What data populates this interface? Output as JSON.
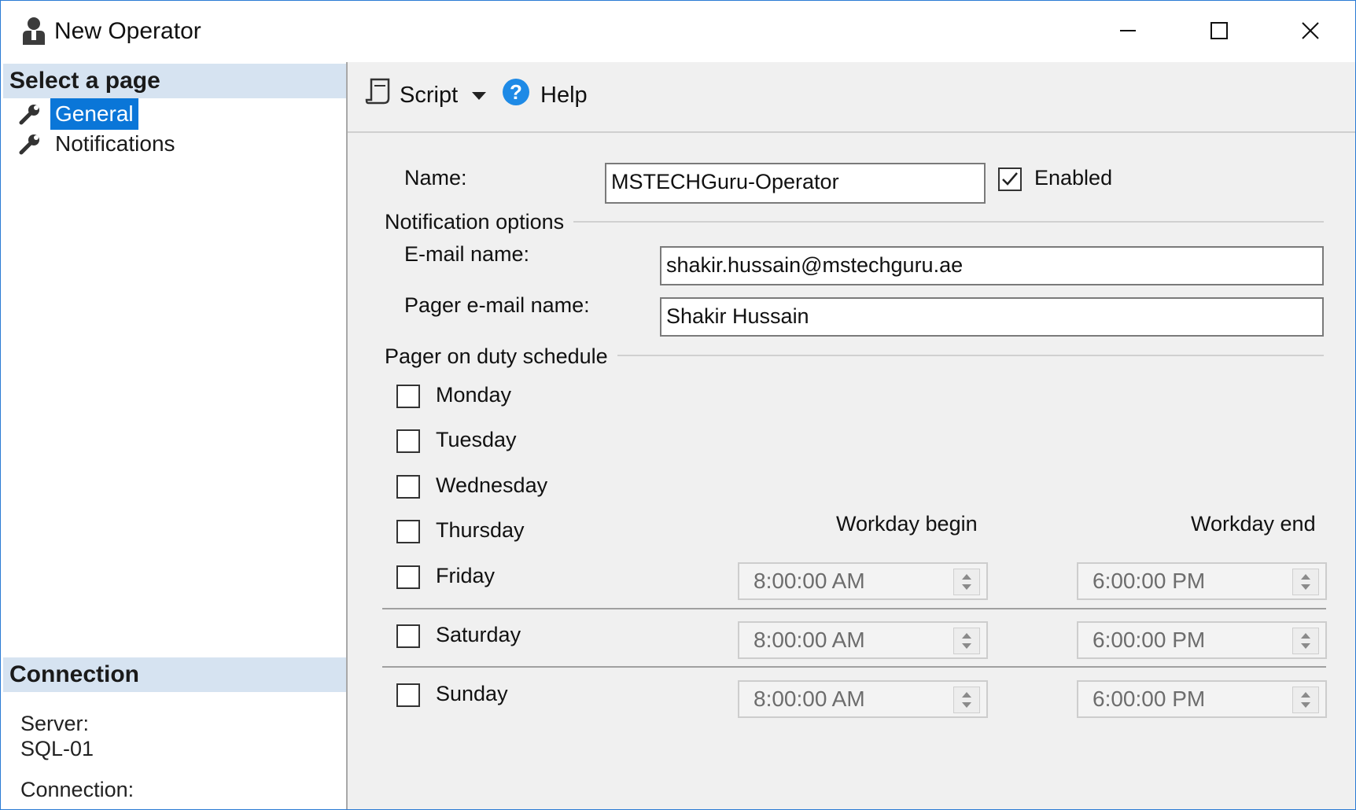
{
  "window": {
    "title": "New Operator"
  },
  "sidebar": {
    "select_header": "Select a page",
    "items": [
      {
        "label": "General",
        "selected": true
      },
      {
        "label": "Notifications",
        "selected": false
      }
    ],
    "connection_header": "Connection",
    "server_label": "Server:",
    "server_value": "SQL-01",
    "connection_label": "Connection:"
  },
  "toolbar": {
    "script_label": "Script",
    "help_label": "Help"
  },
  "form": {
    "name_label": "Name:",
    "name_value": "MSTECHGuru-Operator",
    "enabled_label": "Enabled",
    "enabled_checked": true,
    "notification_options_label": "Notification options",
    "email_label": "E-mail name:",
    "email_value": "shakir.hussain@mstechguru.ae",
    "pager_label": "Pager e-mail name:",
    "pager_value": "Shakir Hussain",
    "schedule_label": "Pager on duty schedule",
    "days": [
      "Monday",
      "Tuesday",
      "Wednesday",
      "Thursday",
      "Friday",
      "Saturday",
      "Sunday"
    ],
    "workday_begin_label": "Workday begin",
    "workday_end_label": "Workday end",
    "weekday_begin": "8:00:00 AM",
    "weekday_end": "6:00:00 PM",
    "saturday_begin": "8:00:00 AM",
    "saturday_end": "6:00:00 PM",
    "sunday_begin": "8:00:00 AM",
    "sunday_end": "6:00:00 PM"
  },
  "colors": {
    "selection": "#0a76d8",
    "header_bg": "#d6e3f1",
    "help_icon": "#1e8ae6"
  }
}
